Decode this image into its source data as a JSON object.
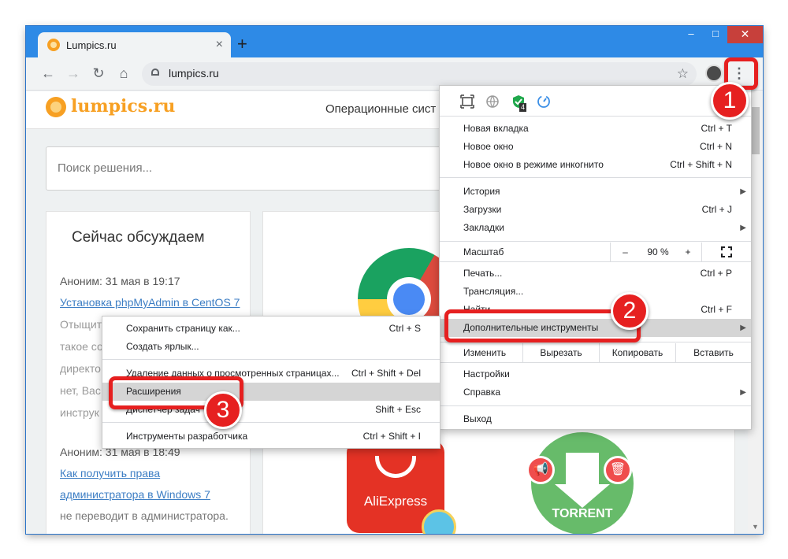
{
  "browser": {
    "tab_title": "Lumpics.ru",
    "tab_close": "×",
    "new_tab": "+",
    "minimize": "–",
    "maximize": "□",
    "close": "✕",
    "url": "lumpics.ru",
    "back": "←",
    "forward": "→",
    "reload": "↻",
    "home": "⌂",
    "bookmark_star": "☆",
    "menu_kebab": "⋮"
  },
  "site": {
    "logo_text": "lumpics.ru",
    "nav_text": "Операционные сист",
    "search_placeholder": "Поиск решения...",
    "discuss_title": "Сейчас обсуждаем",
    "comments": [
      {
        "text": "Аноним: 31 мая в 19:17",
        "kind": "author"
      },
      {
        "text": "Установка phpMyAdmin в CentOS 7",
        "kind": "link"
      },
      {
        "text": "Отыщит",
        "kind": "gray"
      },
      {
        "text": "такое со",
        "kind": "gray"
      },
      {
        "text": "директо",
        "kind": "gray"
      },
      {
        "text": "нет, Вас",
        "kind": "gray"
      },
      {
        "text": "инструк",
        "kind": "gray"
      },
      {
        "text": "Аноним: 31 мая в 18:49",
        "kind": "author"
      },
      {
        "text": "Как получить права",
        "kind": "link"
      },
      {
        "text": "администратора в Windows 7",
        "kind": "link"
      },
      {
        "text": "не переводит в администратора.",
        "kind": "author"
      }
    ],
    "aliexpress_label": "AliExpress",
    "torrent_label": "TORRENT"
  },
  "chrome_menu": {
    "new_tab": {
      "label": "Новая вкладка",
      "shortcut": "Ctrl + T"
    },
    "new_window": {
      "label": "Новое окно",
      "shortcut": "Ctrl + N"
    },
    "incognito": {
      "label": "Новое окно в режиме инкогнито",
      "shortcut": "Ctrl + Shift + N"
    },
    "history": {
      "label": "История"
    },
    "downloads": {
      "label": "Загрузки",
      "shortcut": "Ctrl + J"
    },
    "bookmarks": {
      "label": "Закладки"
    },
    "zoom": {
      "label": "Масштаб",
      "minus": "–",
      "value": "90 %",
      "plus": "+"
    },
    "print": {
      "label": "Печать...",
      "shortcut": "Ctrl + P"
    },
    "cast": {
      "label": "Трансляция..."
    },
    "find": {
      "label": "Найти...",
      "shortcut": "Ctrl + F"
    },
    "more_tools": {
      "label": "Дополнительные инструменты"
    },
    "edit": {
      "label": "Изменить",
      "cut": "Вырезать",
      "copy": "Копировать",
      "paste": "Вставить"
    },
    "settings": {
      "label": "Настройки"
    },
    "help": {
      "label": "Справка"
    },
    "exit": {
      "label": "Выход"
    },
    "extension_badge": "4"
  },
  "more_tools_menu": {
    "save_page": {
      "label": "Сохранить страницу как...",
      "shortcut": "Ctrl + S"
    },
    "create_shortcut": {
      "label": "Создать ярлык..."
    },
    "clear_data": {
      "label": "Удаление данных о просмотренных страницах...",
      "shortcut": "Ctrl + Shift + Del"
    },
    "extensions": {
      "label": "Расширения"
    },
    "task_manager": {
      "label": "Диспетчер задач",
      "shortcut": "Shift + Esc"
    },
    "dev_tools": {
      "label": "Инструменты разработчика",
      "shortcut": "Ctrl + Shift + I"
    }
  },
  "annotations": {
    "step1": "1",
    "step2": "2",
    "step3": "3",
    "color": "#e62020"
  }
}
